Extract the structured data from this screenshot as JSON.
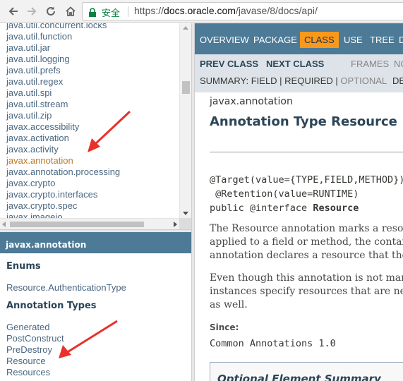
{
  "browser": {
    "back_icon": "back-arrow-icon",
    "forward_icon": "forward-arrow-icon",
    "reload_icon": "reload-icon",
    "home_icon": "home-icon",
    "security_label": "安全",
    "url_scheme": "https://",
    "url_host": "docs.oracle.com",
    "url_path": "/javase/8/docs/api/"
  },
  "packages": {
    "items": [
      "java.util.concurrent.locks",
      "java.util.function",
      "java.util.jar",
      "java.util.logging",
      "java.util.prefs",
      "java.util.regex",
      "java.util.spi",
      "java.util.stream",
      "java.util.zip",
      "javax.accessibility",
      "javax.activation",
      "javax.activity",
      "javax.annotation",
      "javax.annotation.processing",
      "javax.crypto",
      "javax.crypto.interfaces",
      "javax.crypto.spec",
      "javax.imageio"
    ],
    "current_index": 12
  },
  "classes": {
    "package_name": "javax.annotation",
    "enums_title": "Enums",
    "enums": [
      "Resource.AuthenticationType"
    ],
    "annotation_types_title": "Annotation Types",
    "annotation_types": [
      "Generated",
      "PostConstruct",
      "PreDestroy",
      "Resource",
      "Resources"
    ]
  },
  "content": {
    "topnav": {
      "overview": "OVERVIEW",
      "package": "PACKAGE",
      "class": "CLASS",
      "use": "USE",
      "tree": "TREE",
      "deprecated_partial": "D"
    },
    "subnav": {
      "prev_class": "PREV CLASS",
      "next_class": "NEXT CLASS",
      "frames": "FRAMES",
      "no_frames_partial": "NO",
      "summary_prefix": "SUMMARY: ",
      "field": "FIELD",
      "sep1": " | ",
      "required": "REQUIRED",
      "sep2": " | ",
      "optional": "OPTIONAL",
      "detail_partial": "DE"
    },
    "package_label": "javax.annotation",
    "title": "Annotation Type Resource",
    "sig_line1": "@Target(value={TYPE,FIELD,METHOD})",
    "sig_line2": " @Retention(value=RUNTIME)",
    "sig_line3_prefix": "public @interface ",
    "sig_line3_name": "Resource",
    "para1": [
      "The Resource annotation marks a resource that is needed",
      "applied to a field or method, the container will inject",
      "annotation declares a resource that the application will"
    ],
    "para2": [
      "Even though this annotation is not marked Inherited, dep",
      "instances specify resources that are needed by the appli",
      "as well."
    ],
    "since_label": "Since:",
    "since_value": "Common Annotations 1.0",
    "optional_summary_title": "Optional Element Summary"
  },
  "colors": {
    "nav_bar": "#4d7a97",
    "active_tab": "#f8981d",
    "subnav_bg": "#dee3e9",
    "link": "#4a6782",
    "current_package": "#bb7a2a",
    "annotation_arrow": "#e8312a"
  }
}
